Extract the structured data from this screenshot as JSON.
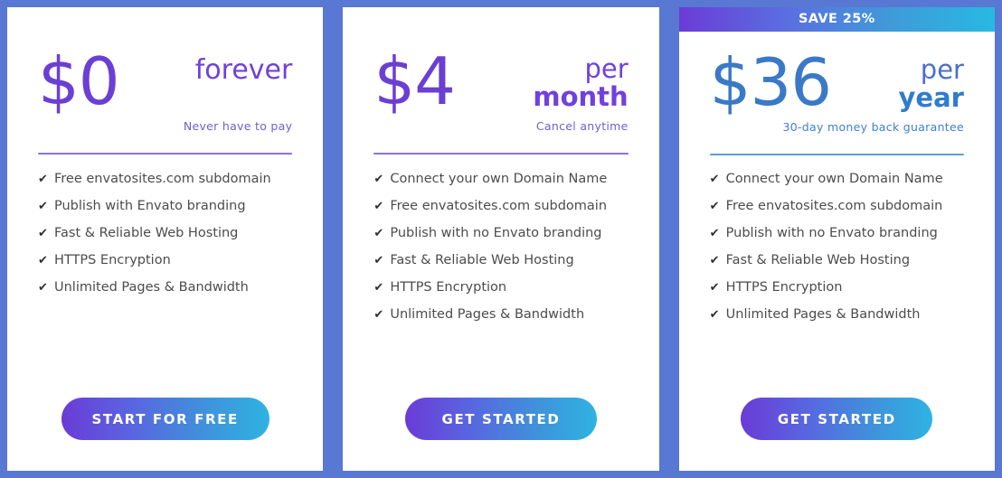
{
  "theme": {
    "page_background": "#5878d4",
    "card_background": "#ffffff",
    "purple_accent": "#6b3fd4",
    "blue_accent": "#3a79c6",
    "gradient_start": "#6b3bd6",
    "gradient_end": "#27b9e2"
  },
  "plans": [
    {
      "badge": null,
      "amount": "$0",
      "period_top": "",
      "period_bottom": "forever",
      "note": "Never have to pay",
      "features": [
        "Free envatosites.com subdomain",
        "Publish with Envato branding",
        "Fast & Reliable Web Hosting",
        "HTTPS Encryption",
        "Unlimited Pages & Bandwidth"
      ],
      "cta_label": "START FOR FREE",
      "check_glyph": "✔"
    },
    {
      "badge": null,
      "amount": "$4",
      "period_top": "per",
      "period_bottom": "month",
      "note": "Cancel anytime",
      "features": [
        "Connect your own Domain Name",
        "Free envatosites.com subdomain",
        "Publish with no Envato branding",
        "Fast & Reliable Web Hosting",
        "HTTPS Encryption",
        "Unlimited Pages & Bandwidth"
      ],
      "cta_label": "GET STARTED",
      "check_glyph": "✔"
    },
    {
      "badge": "SAVE 25%",
      "amount": "$36",
      "period_top": "per",
      "period_bottom": "year",
      "note": "30-day money back guarantee",
      "features": [
        "Connect your own Domain Name",
        "Free envatosites.com subdomain",
        "Publish with no Envato branding",
        "Fast & Reliable Web Hosting",
        "HTTPS Encryption",
        "Unlimited Pages & Bandwidth"
      ],
      "cta_label": "GET STARTED",
      "check_glyph": "✔"
    }
  ]
}
